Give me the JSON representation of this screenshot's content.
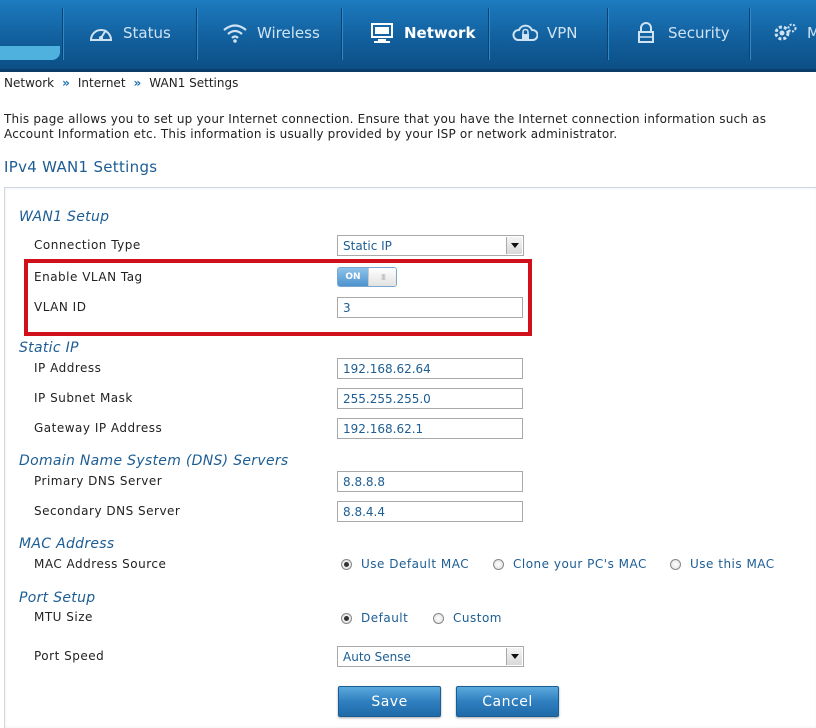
{
  "nav": {
    "items": [
      {
        "label": "Status",
        "icon": "dashboard-icon"
      },
      {
        "label": "Wireless",
        "icon": "wifi-icon"
      },
      {
        "label": "Network",
        "icon": "monitor-icon"
      },
      {
        "label": "VPN",
        "icon": "cloud-lock-icon"
      },
      {
        "label": "Security",
        "icon": "padlock-icon"
      },
      {
        "label": "M",
        "icon": "gears-icon"
      }
    ]
  },
  "breadcrumb": [
    "Network",
    "»",
    "Internet",
    "»",
    "WAN1 Settings"
  ],
  "description": {
    "line1": "This page allows you to set up your Internet connection. Ensure that you have the Internet connection information such as",
    "line2": "Account Information etc. This information is usually provided by your ISP or network administrator."
  },
  "page_title": "IPv4 WAN1 Settings",
  "wan1_setup": {
    "title": "WAN1 Setup",
    "connection_type_label": "Connection Type",
    "connection_type_value": "Static IP",
    "enable_vlan_label": "Enable VLAN Tag",
    "vlan_toggle_on": "ON",
    "vlan_toggle_knob": "III",
    "vlan_id_label": "VLAN ID",
    "vlan_id_value": "3"
  },
  "static_ip": {
    "title": "Static IP",
    "ip_label": "IP Address",
    "ip_value": "192.168.62.64",
    "mask_label": "IP Subnet Mask",
    "mask_value": "255.255.255.0",
    "gateway_label": "Gateway IP Address",
    "gateway_value": "192.168.62.1"
  },
  "dns": {
    "title": "Domain Name System (DNS) Servers",
    "primary_label": "Primary DNS Server",
    "primary_value": "8.8.8.8",
    "secondary_label": "Secondary DNS Server",
    "secondary_value": "8.8.4.4"
  },
  "mac": {
    "title": "MAC Address",
    "source_label": "MAC Address Source",
    "options": [
      "Use Default MAC",
      "Clone your PC's MAC",
      "Use this MAC"
    ]
  },
  "port": {
    "title": "Port Setup",
    "mtu_label": "MTU Size",
    "mtu_options": [
      "Default",
      "Custom"
    ],
    "speed_label": "Port Speed",
    "speed_value": "Auto Sense"
  },
  "buttons": {
    "save": "Save",
    "cancel": "Cancel"
  },
  "colors": {
    "accent": "#1d5d94",
    "highlight": "#d0101b",
    "nav": "#12609e"
  }
}
